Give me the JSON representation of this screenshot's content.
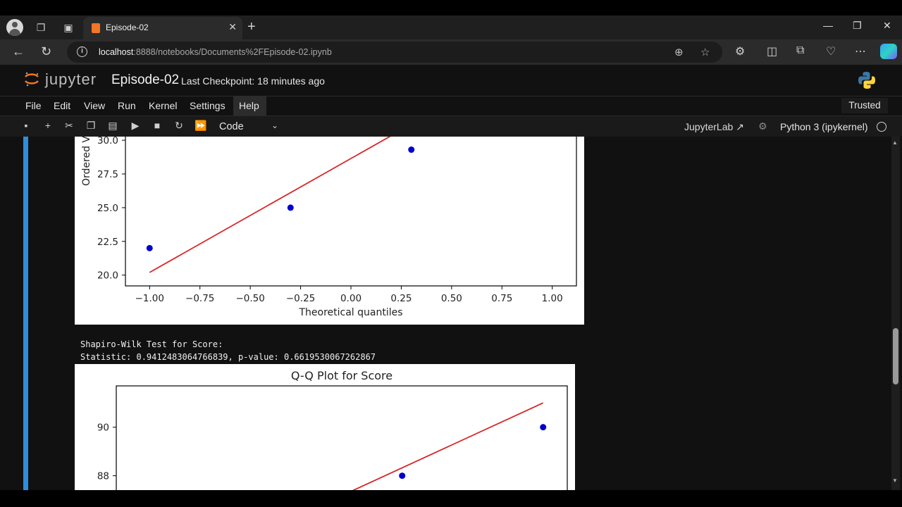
{
  "browser": {
    "tab_title": "Episode-02",
    "url_host": "localhost",
    "url_rest": ":8888/notebooks/Documents%2FEpisode-02.ipynb",
    "icons": [
      "profile-avatar",
      "workspaces-icon",
      "tab-actions-icon",
      "back-arrow-icon",
      "reload-icon",
      "info-icon",
      "zoom-icon",
      "favorite-star-icon",
      "extensions-icon",
      "split-screen-icon",
      "collections-icon",
      "health-icon",
      "more-icon",
      "copilot-icon"
    ]
  },
  "jupyter": {
    "brand": "jupyter",
    "notebook_title": "Episode-02",
    "checkpoint": "Last Checkpoint: 18 minutes ago",
    "menu": [
      "File",
      "Edit",
      "View",
      "Run",
      "Kernel",
      "Settings",
      "Help"
    ],
    "trusted": "Trusted",
    "cell_type": "Code",
    "jupyterlab_link": "JupyterLab",
    "kernel_name": "Python 3 (ipykernel)",
    "colors": {
      "accent": "#2f8dde",
      "jupyter_orange": "#f37626"
    }
  },
  "output": {
    "stdout_line1": "Shapiro-Wilk Test for Score:",
    "stdout_line2": "Statistic: 0.9412483064766839, p-value: 0.6619530067262867"
  },
  "chart_data": [
    {
      "type": "scatter",
      "title": "",
      "xlabel": "Theoretical quantiles",
      "ylabel": "Ordered V",
      "xticks": [
        "−1.00",
        "−0.75",
        "−0.50",
        "−0.25",
        "0.00",
        "0.25",
        "0.50",
        "0.75",
        "1.00"
      ],
      "yticks": [
        "20.0",
        "22.5",
        "25.0",
        "27.5",
        "30.0"
      ],
      "points": [
        {
          "x": -1.0,
          "y": 22.0
        },
        {
          "x": -0.3,
          "y": 25.0
        },
        {
          "x": 0.3,
          "y": 29.3
        }
      ],
      "fit_line": {
        "x": [
          -1.0,
          0.35
        ],
        "y": [
          20.2,
          31.6
        ]
      },
      "xlim": [
        -1.12,
        1.12
      ],
      "ylim": [
        19.2,
        31.0
      ],
      "point_color": "#0000cc",
      "line_color": "#d62728"
    },
    {
      "type": "scatter",
      "title": "Q-Q Plot for Score",
      "xlabel": "",
      "ylabel": "",
      "yticks": [
        "88",
        "90"
      ],
      "points": [
        {
          "x": 0.3,
          "y": 88.0
        },
        {
          "x": 1.0,
          "y": 90.0
        }
      ],
      "fit_line": {
        "x": [
          -0.1,
          1.0
        ],
        "y": [
          86.8,
          91.0
        ]
      },
      "xlim": [
        -1.12,
        1.12
      ],
      "ylim": [
        86.8,
        91.7
      ],
      "point_color": "#0000cc",
      "line_color": "#d62728"
    }
  ]
}
